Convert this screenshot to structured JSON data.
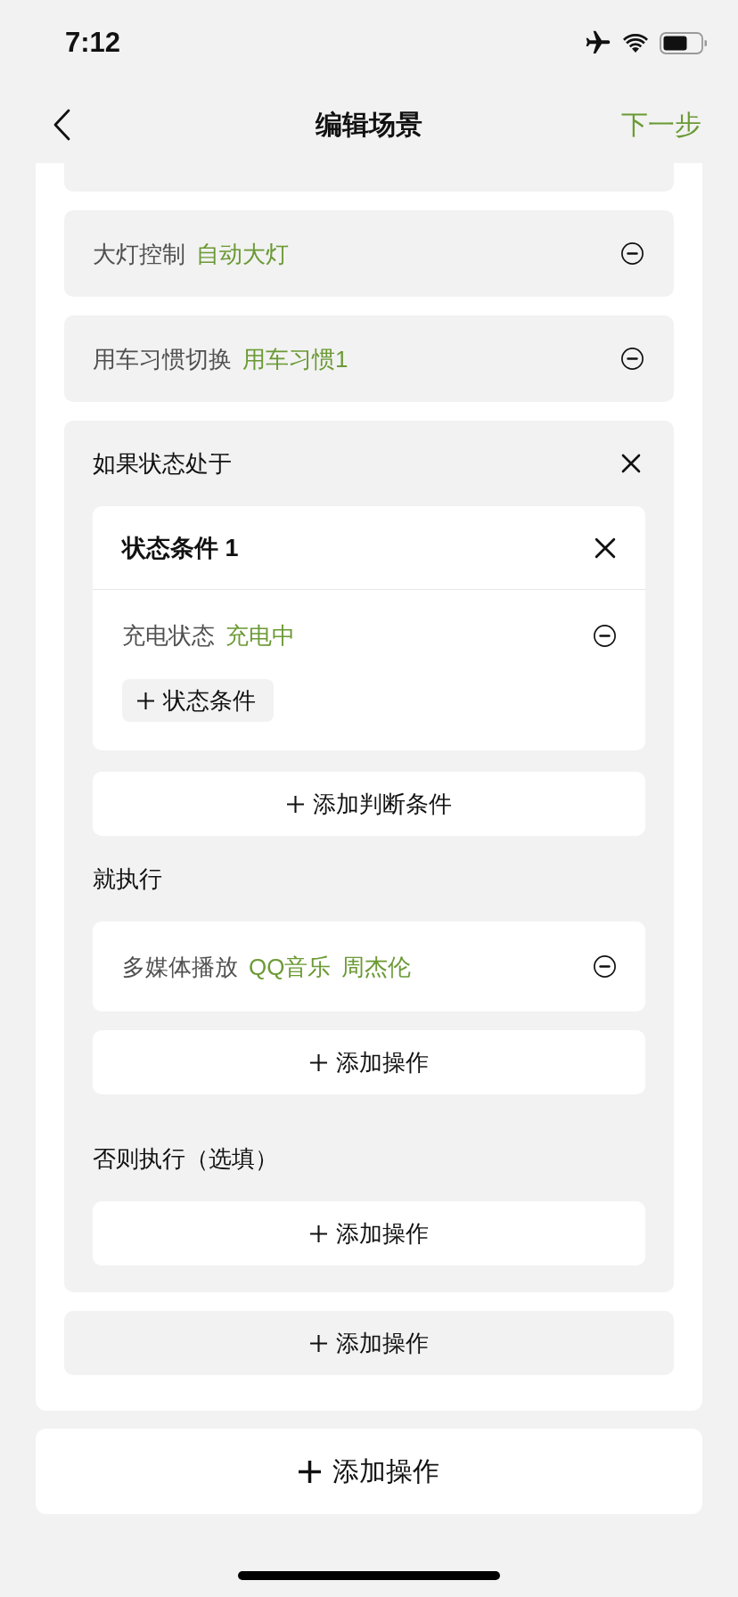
{
  "status_bar": {
    "time": "7:12"
  },
  "nav": {
    "title": "编辑场景",
    "next": "下一步"
  },
  "actions": [
    {
      "kind": "item",
      "label": "大灯控制",
      "values": [
        "自动大灯"
      ]
    },
    {
      "kind": "item",
      "label": "用车习惯切换",
      "values": [
        "用车习惯1"
      ]
    },
    {
      "kind": "condition",
      "title": "如果状态处于",
      "groups": [
        {
          "title": "状态条件 1",
          "items": [
            {
              "label": "充电状态",
              "values": [
                "充电中"
              ]
            }
          ],
          "add_label": "状态条件"
        }
      ],
      "add_group_label": "添加判断条件",
      "then": {
        "title": "就执行",
        "items": [
          {
            "label": "多媒体播放",
            "values": [
              "QQ音乐",
              "周杰伦"
            ]
          }
        ],
        "add_label": "添加操作"
      },
      "otherwise": {
        "title": "否则执行（选填）",
        "add_label": "添加操作"
      }
    },
    {
      "kind": "add",
      "label": "添加操作"
    }
  ],
  "add_button": {
    "label": "添加操作"
  }
}
